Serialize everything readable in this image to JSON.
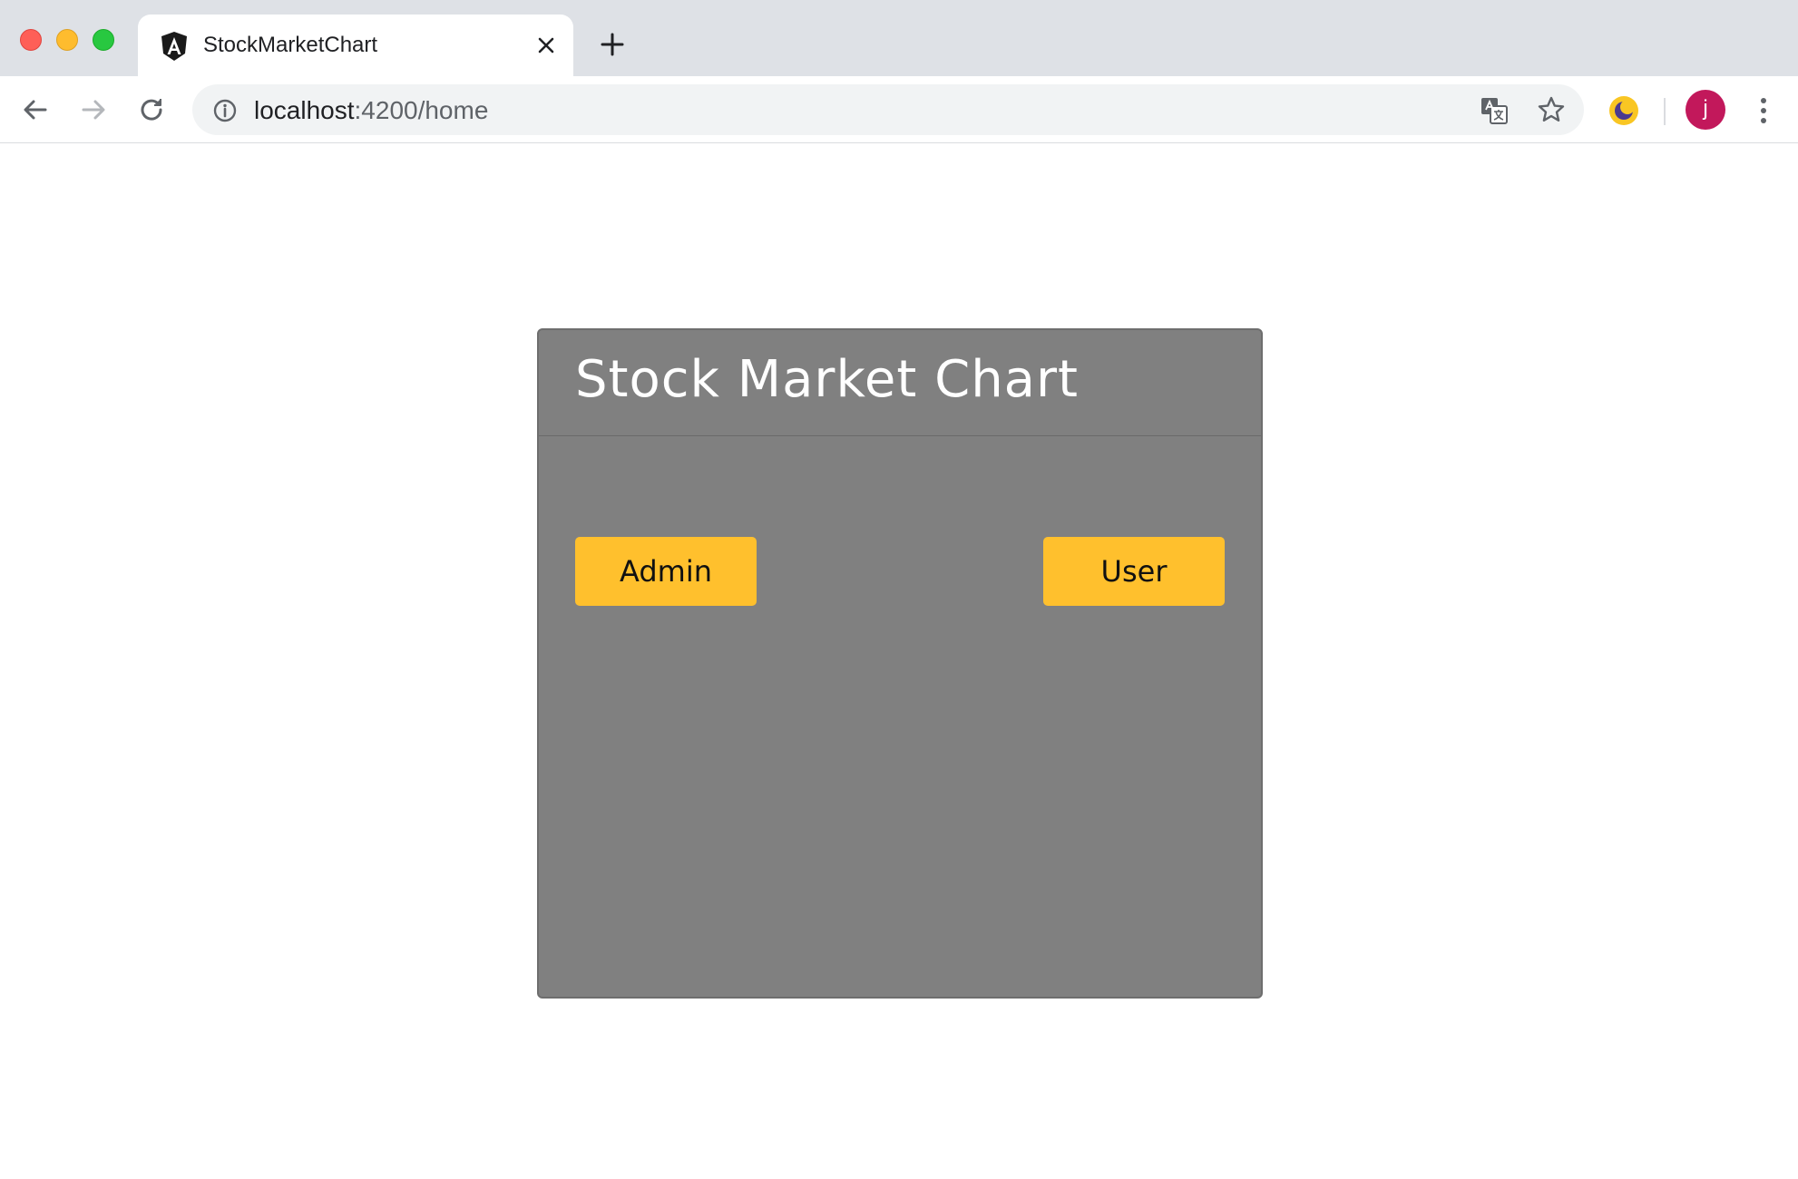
{
  "browser": {
    "tab": {
      "title": "StockMarketChart",
      "favicon": "angular-icon"
    },
    "address_bar": {
      "host": "localhost",
      "path": ":4200/home"
    },
    "profile": {
      "initial": "j",
      "color": "#c2185b"
    }
  },
  "page": {
    "card": {
      "title": "Stock Market Chart",
      "background": "#808080",
      "buttons": {
        "admin_label": "Admin",
        "user_label": "User",
        "color": "#ffc02d"
      }
    }
  }
}
